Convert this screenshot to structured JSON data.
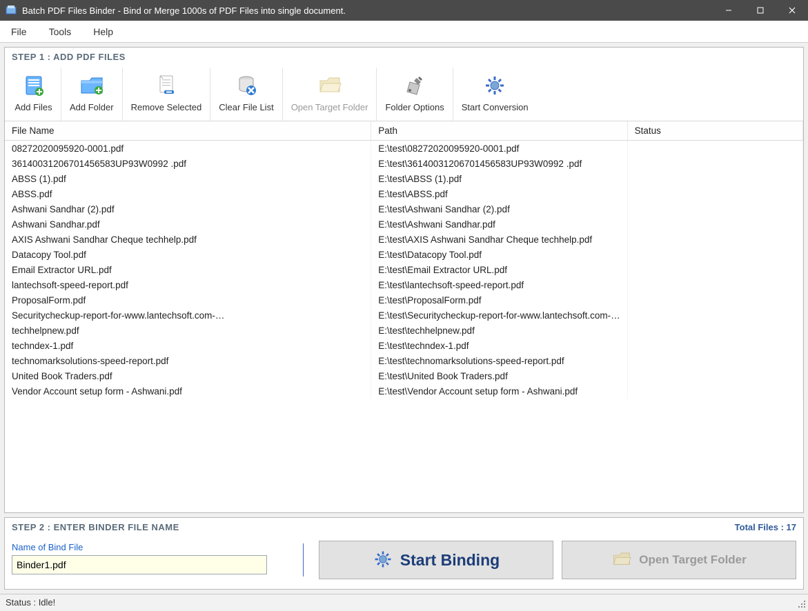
{
  "window": {
    "title": "Batch PDF Files Binder - Bind or Merge 1000s of PDF Files into single document."
  },
  "menu": {
    "file": "File",
    "tools": "Tools",
    "help": "Help"
  },
  "step1": {
    "title": "STEP 1 : ADD PDF FILES",
    "buttons": {
      "add_files": "Add Files",
      "add_folder": "Add Folder",
      "remove_selected": "Remove Selected",
      "clear_file_list": "Clear File List",
      "open_target_folder": "Open Target Folder",
      "folder_options": "Folder Options",
      "start_conversion": "Start Conversion"
    }
  },
  "grid": {
    "headers": {
      "filename": "File Name",
      "path": "Path",
      "status": "Status"
    },
    "rows": [
      {
        "name": "08272020095920-0001.pdf",
        "path": "E:\\test\\08272020095920-0001.pdf",
        "status": ""
      },
      {
        "name": "36140031206701456583UP93W0992 .pdf",
        "path": "E:\\test\\36140031206701456583UP93W0992 .pdf",
        "status": ""
      },
      {
        "name": "ABSS (1).pdf",
        "path": "E:\\test\\ABSS (1).pdf",
        "status": ""
      },
      {
        "name": "ABSS.pdf",
        "path": "E:\\test\\ABSS.pdf",
        "status": ""
      },
      {
        "name": "Ashwani Sandhar (2).pdf",
        "path": "E:\\test\\Ashwani Sandhar (2).pdf",
        "status": ""
      },
      {
        "name": "Ashwani Sandhar.pdf",
        "path": "E:\\test\\Ashwani Sandhar.pdf",
        "status": ""
      },
      {
        "name": "AXIS Ashwani Sandhar Cheque techhelp.pdf",
        "path": "E:\\test\\AXIS Ashwani Sandhar Cheque techhelp.pdf",
        "status": ""
      },
      {
        "name": "Datacopy Tool.pdf",
        "path": "E:\\test\\Datacopy Tool.pdf",
        "status": ""
      },
      {
        "name": "Email Extractor URL.pdf",
        "path": "E:\\test\\Email Extractor URL.pdf",
        "status": ""
      },
      {
        "name": "lantechsoft-speed-report.pdf",
        "path": "E:\\test\\lantechsoft-speed-report.pdf",
        "status": ""
      },
      {
        "name": "ProposalForm.pdf",
        "path": "E:\\test\\ProposalForm.pdf",
        "status": ""
      },
      {
        "name": "Securitycheckup-report-for-www.lantechsoft.com-…",
        "path": "E:\\test\\Securitycheckup-report-for-www.lantechsoft.com-…",
        "status": ""
      },
      {
        "name": "techhelpnew.pdf",
        "path": "E:\\test\\techhelpnew.pdf",
        "status": ""
      },
      {
        "name": "techndex-1.pdf",
        "path": "E:\\test\\techndex-1.pdf",
        "status": ""
      },
      {
        "name": "technomarksolutions-speed-report.pdf",
        "path": "E:\\test\\technomarksolutions-speed-report.pdf",
        "status": ""
      },
      {
        "name": "United Book Traders.pdf",
        "path": "E:\\test\\United Book Traders.pdf",
        "status": ""
      },
      {
        "name": "Vendor Account setup form - Ashwani.pdf",
        "path": "E:\\test\\Vendor Account setup form - Ashwani.pdf",
        "status": ""
      }
    ]
  },
  "step2": {
    "title": "STEP 2 : ENTER BINDER FILE NAME",
    "total_files_label": "Total Files : 17",
    "bind_name_label": "Name of Bind File",
    "bind_name_value": "Binder1.pdf",
    "start_binding": "Start Binding",
    "open_target_folder": "Open Target Folder"
  },
  "statusbar": {
    "text": "Status  :  Idle!"
  }
}
